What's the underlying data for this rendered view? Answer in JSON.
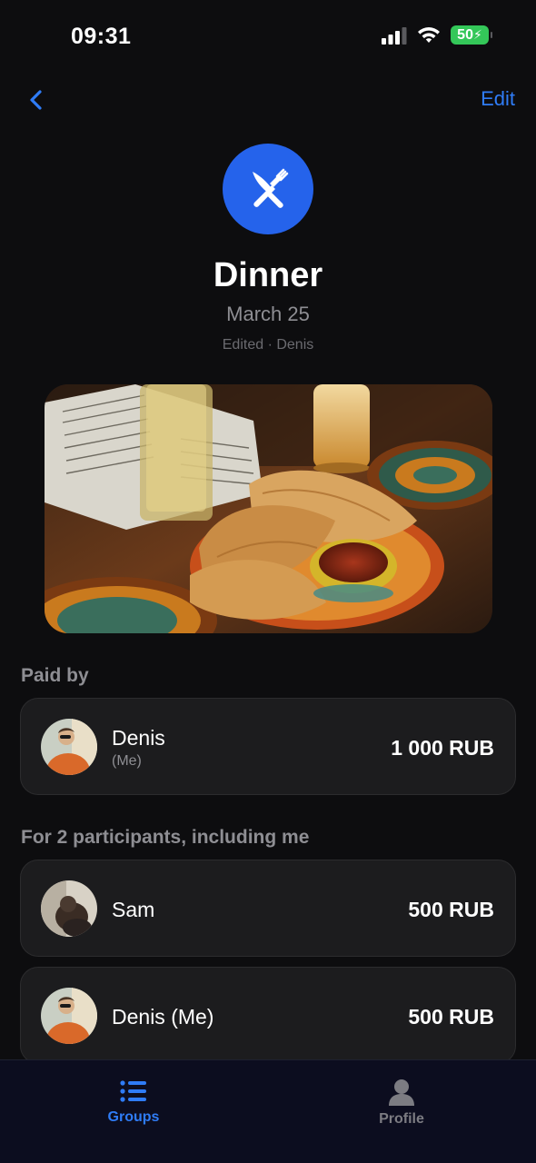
{
  "status_bar": {
    "time": "09:31",
    "battery": "50"
  },
  "nav": {
    "edit_label": "Edit"
  },
  "expense": {
    "title": "Dinner",
    "date": "March 25",
    "edited": "Edited · Denis",
    "icon": "fork-knife-icon"
  },
  "paid_by": {
    "label": "Paid by",
    "name": "Denis",
    "sub": "(Me)",
    "amount": "1 000 RUB"
  },
  "participants": {
    "label": "For 2 participants, including me",
    "items": [
      {
        "name": "Sam",
        "amount": "500 RUB"
      },
      {
        "name": "Denis (Me)",
        "amount": "500 RUB"
      }
    ]
  },
  "tab_bar": {
    "tabs": [
      {
        "label": "Groups",
        "icon": "list-icon",
        "active": true
      },
      {
        "label": "Profile",
        "icon": "person-icon",
        "active": false
      }
    ]
  },
  "colors": {
    "accent": "#2f7cf6",
    "icon_bg": "#2563eb",
    "background": "#0d0d0f",
    "card": "#1c1c1e",
    "battery": "#34c759"
  }
}
